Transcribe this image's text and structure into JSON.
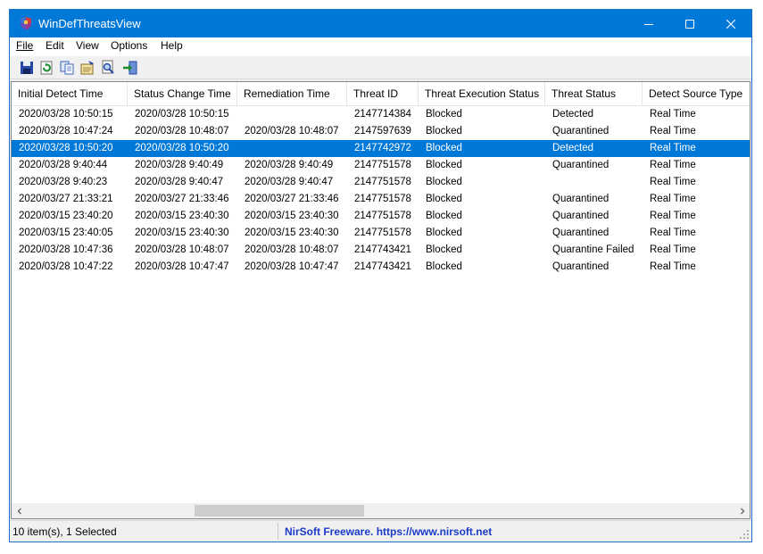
{
  "window": {
    "title": "WinDefThreatsView"
  },
  "menu": [
    {
      "label": "File"
    },
    {
      "label": "Edit"
    },
    {
      "label": "View"
    },
    {
      "label": "Options"
    },
    {
      "label": "Help"
    }
  ],
  "toolbar": [
    {
      "icon": "save-icon"
    },
    {
      "icon": "refresh-icon"
    },
    {
      "icon": "copy-icon"
    },
    {
      "icon": "properties-icon"
    },
    {
      "icon": "find-icon"
    },
    {
      "icon": "exit-icon"
    }
  ],
  "columns": [
    "Initial Detect Time",
    "Status Change Time",
    "Remediation Time",
    "Threat ID",
    "Threat Execution Status",
    "Threat Status",
    "Detect Source Type"
  ],
  "rows": [
    [
      "2020/03/28 10:50:15",
      "2020/03/28 10:50:15",
      "",
      "2147714384",
      "Blocked",
      "Detected",
      "Real Time"
    ],
    [
      "2020/03/28 10:47:24",
      "2020/03/28 10:48:07",
      "2020/03/28 10:48:07",
      "2147597639",
      "Blocked",
      "Quarantined",
      "Real Time"
    ],
    [
      "2020/03/28 10:50:20",
      "2020/03/28 10:50:20",
      "",
      "2147742972",
      "Blocked",
      "Detected",
      "Real Time"
    ],
    [
      "2020/03/28 9:40:44",
      "2020/03/28 9:40:49",
      "2020/03/28 9:40:49",
      "2147751578",
      "Blocked",
      "Quarantined",
      "Real Time"
    ],
    [
      "2020/03/28 9:40:23",
      "2020/03/28 9:40:47",
      "2020/03/28 9:40:47",
      "2147751578",
      "Blocked",
      "",
      "Real Time"
    ],
    [
      "2020/03/27 21:33:21",
      "2020/03/27 21:33:46",
      "2020/03/27 21:33:46",
      "2147751578",
      "Blocked",
      "Quarantined",
      "Real Time"
    ],
    [
      "2020/03/15 23:40:20",
      "2020/03/15 23:40:30",
      "2020/03/15 23:40:30",
      "2147751578",
      "Blocked",
      "Quarantined",
      "Real Time"
    ],
    [
      "2020/03/15 23:40:05",
      "2020/03/15 23:40:30",
      "2020/03/15 23:40:30",
      "2147751578",
      "Blocked",
      "Quarantined",
      "Real Time"
    ],
    [
      "2020/03/28 10:47:36",
      "2020/03/28 10:48:07",
      "2020/03/28 10:48:07",
      "2147743421",
      "Blocked",
      "Quarantine Failed",
      "Real Time"
    ],
    [
      "2020/03/28 10:47:22",
      "2020/03/28 10:47:47",
      "2020/03/28 10:47:47",
      "2147743421",
      "Blocked",
      "Quarantined",
      "Real Time"
    ]
  ],
  "selected_row": 2,
  "status": {
    "count": "10 item(s), 1 Selected",
    "credit": "NirSoft Freeware. https://www.nirsoft.net"
  },
  "colors": {
    "titlebar": "#0078d7",
    "selection": "#0078d7",
    "credit_text": "#1a3cc8"
  }
}
